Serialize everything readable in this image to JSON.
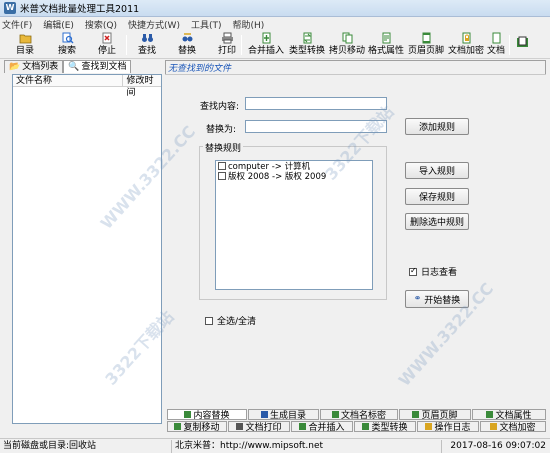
{
  "window": {
    "title": "米普文档批量处理工具2011"
  },
  "menu": [
    "文件(F)",
    "编辑(E)",
    "搜索(Q)",
    "快捷方式(W)",
    "工具(T)",
    "帮助(H)"
  ],
  "toolbar": [
    {
      "label": "目录",
      "icon": "folder-icon",
      "color": "#d9a520"
    },
    {
      "label": "搜索",
      "icon": "search-doc-icon",
      "color": "#2f6fcf"
    },
    {
      "label": "停止",
      "icon": "stop-icon",
      "color": "#d02020"
    },
    {
      "label": "查找",
      "icon": "binoculars-icon",
      "color": "#2a5aa8"
    },
    {
      "label": "替换",
      "icon": "replace-icon",
      "color": "#2a5aa8"
    },
    {
      "label": "打印",
      "icon": "print-icon",
      "color": "#555555"
    },
    {
      "label": "合并插入",
      "icon": "merge-icon",
      "color": "#3a8a3a"
    },
    {
      "label": "类型转换",
      "icon": "convert-icon",
      "color": "#3a8a3a"
    },
    {
      "label": "拷贝移动",
      "icon": "copy-move-icon",
      "color": "#3a8a3a"
    },
    {
      "label": "格式属性",
      "icon": "format-icon",
      "color": "#3a8a3a"
    },
    {
      "label": "页眉页脚",
      "icon": "header-footer-icon",
      "color": "#3a8a3a"
    },
    {
      "label": "文档加密",
      "icon": "encrypt-icon",
      "color": "#d9a520"
    },
    {
      "label": "文档",
      "icon": "doc-icon",
      "color": "#3a8a3a"
    }
  ],
  "left_tabs": [
    {
      "label": "文档列表"
    },
    {
      "label": "查找到文档"
    }
  ],
  "file_list": {
    "columns": [
      "文件名称",
      "修改时间"
    ]
  },
  "panel": {
    "header": "无查找到的文件",
    "find_label": "查找内容:",
    "find_value": "",
    "replace_label": "替换为:",
    "replace_value": "",
    "rules_group": "替换规则",
    "rules": [
      "computer -> 计算机",
      "版权 2008 -> 版权 2009"
    ],
    "buttons": {
      "add_rule": "添加规则",
      "import_rule": "导入规则",
      "save_rule": "保存规则",
      "delete_rule": "删除选中规则",
      "start": "开始替换"
    },
    "log_label": "日志查看",
    "log_checked": true,
    "select_all_label": "全选/全清",
    "select_all_checked": false
  },
  "bottom_tabs_row1": [
    "内容替换",
    "生成目录",
    "文档名标密",
    "页眉页脚",
    "文档属性"
  ],
  "bottom_tabs_row2": [
    "复制移动",
    "文档打印",
    "合并插入",
    "类型转换",
    "操作日志",
    "文档加密"
  ],
  "status": {
    "left": "当前磁盘或目录:回收站",
    "center": "北京米普：http://www.mipsoft.net",
    "right": "2017-08-16 09:07:02"
  },
  "watermark": "3322下载站",
  "watermark_domain": "WWW.3322.CC"
}
